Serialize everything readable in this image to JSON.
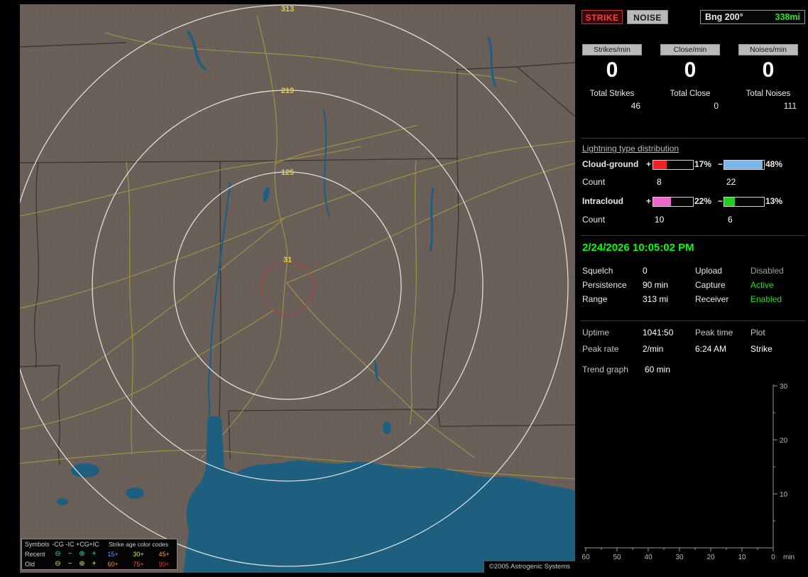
{
  "map": {
    "range_ring_labels": [
      "313",
      "219",
      "125",
      "31"
    ],
    "copyright": "©2005 Astrogenic Systems",
    "colors": {
      "land": "#6b6059",
      "water": "#1e5f80",
      "road": "#a6a23b",
      "range_ring": "#e9e9e9",
      "range_label": "#e3cd4f",
      "close_alarm_circle": "#e03030"
    },
    "legend": {
      "symbols_header": "Symbols",
      "symbol_cols": [
        "-CG",
        "-IC",
        "+CG",
        "+IC"
      ],
      "symbol_glyphs": [
        "⊖",
        "−",
        "⊕",
        "+"
      ],
      "age_header": "Strike age color codes",
      "recent_label": "Recent",
      "old_label": "Old",
      "recent_symbol_color": "#3fd9a6",
      "old_symbol_color": "#e0e04a",
      "recent_ages": [
        {
          "label": "15+",
          "color": "#6a9bff"
        },
        {
          "label": "30+",
          "color": "#e8e83a"
        },
        {
          "label": "45+",
          "color": "#ff9933"
        }
      ],
      "old_ages": [
        {
          "label": "60+",
          "color": "#ff8833"
        },
        {
          "label": "75+",
          "color": "#ff5522"
        },
        {
          "label": "90+",
          "color": "#ff2222"
        }
      ]
    }
  },
  "panel": {
    "buttons": {
      "strike": "STRIKE",
      "noise": "NOISE"
    },
    "bearing_box": {
      "bearing": "Bng 200°",
      "distance": "338mi",
      "distance_color": "#22e522"
    },
    "counters": [
      {
        "label": "Strikes/min",
        "value": "0",
        "total_label": "Total Strikes",
        "total_value": "46"
      },
      {
        "label": "Close/min",
        "value": "0",
        "total_label": "Total Close",
        "total_value": "0"
      },
      {
        "label": "Noises/min",
        "value": "0",
        "total_label": "Total Noises",
        "total_value": "111"
      }
    ],
    "distribution": {
      "title": "Lightning type distribution",
      "rows": [
        {
          "label": "Cloud-ground",
          "plus_sign": "+",
          "minus_sign": "−",
          "pos_pct": "17%",
          "neg_pct": "48%",
          "pos_color": "#ee2222",
          "neg_color": "#7ab4e8",
          "count_label": "Count",
          "pos_count": "8",
          "neg_count": "22"
        },
        {
          "label": "Intracloud",
          "plus_sign": "+",
          "minus_sign": "−",
          "pos_pct": "22%",
          "neg_pct": "13%",
          "pos_color": "#ee66cc",
          "neg_color": "#22cc22",
          "count_label": "Count",
          "pos_count": "10",
          "neg_count": "6"
        }
      ]
    },
    "datetime": "2/24/2026 10:05:02 PM",
    "status_rows": [
      {
        "label1": "Squelch",
        "value1": "0",
        "label2": "Upload",
        "value2": "Disabled",
        "value2_state": "gray"
      },
      {
        "label1": "Persistence",
        "value1": "90 min",
        "label2": "Capture",
        "value2": "Active",
        "value2_state": "green"
      },
      {
        "label1": "Range",
        "value1": "313 mi",
        "label2": "Receiver",
        "value2": "Enabled",
        "value2_state": "green"
      }
    ],
    "stats_rows": [
      {
        "c1": "Uptime",
        "c2": "1041:50",
        "c3": "Peak time",
        "c4": "Plot"
      },
      {
        "c1": "Peak rate",
        "c2": "2/min",
        "c3": "6:24 AM",
        "c4": "Strike"
      }
    ],
    "trend_label": "Trend graph",
    "trend_window": "60 min"
  },
  "chart_data": {
    "type": "line",
    "title": "Trend graph",
    "window": "60 min",
    "x_tick_labels": [
      "60",
      "50",
      "40",
      "30",
      "20",
      "10",
      "0"
    ],
    "x_unit": "min",
    "x_range": [
      60,
      0
    ],
    "y_tick_labels": [
      "30",
      "20",
      "10"
    ],
    "y_range": [
      0,
      30
    ],
    "grid": false,
    "series": []
  }
}
